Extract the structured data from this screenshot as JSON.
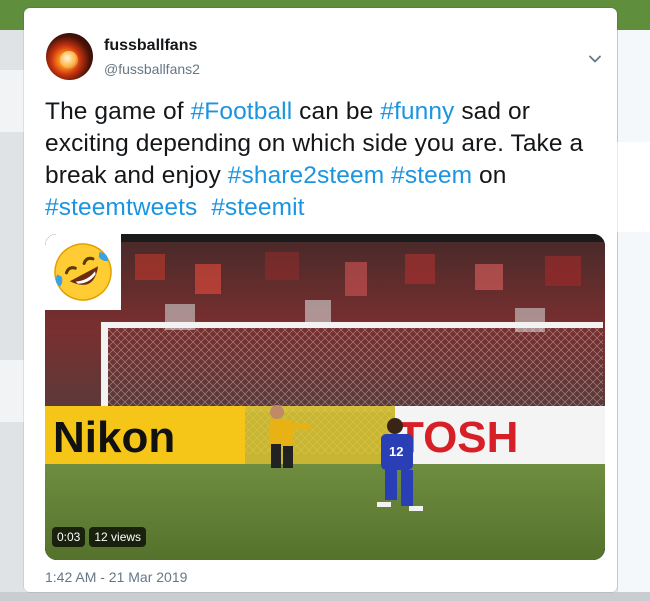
{
  "tweet": {
    "author_name": "fussballfans",
    "author_handle": "@fussballfans2",
    "text_segments": [
      {
        "text": "The game of ",
        "kind": "text"
      },
      {
        "text": "#Football",
        "kind": "hashtag"
      },
      {
        "text": " can be ",
        "kind": "text"
      },
      {
        "text": "#funny",
        "kind": "hashtag"
      },
      {
        "text": " sad or exciting depending on which side you are. Take a break and enjoy ",
        "kind": "text"
      },
      {
        "text": "#share2steem",
        "kind": "hashtag"
      },
      {
        "text": " ",
        "kind": "text"
      },
      {
        "text": "#steem",
        "kind": "hashtag"
      },
      {
        "text": " on ",
        "kind": "text"
      },
      {
        "text": "#steemtweets",
        "kind": "hashtag"
      },
      {
        "text": "  ",
        "kind": "text"
      },
      {
        "text": "#steemit",
        "kind": "hashtag"
      }
    ],
    "timestamp": "1:42 AM - 21 Mar 2019"
  },
  "media": {
    "duration": "0:03",
    "views": "12 views",
    "overlay_emoji": "rolling-on-floor-laughing-emoji",
    "banner_left": "Nikon",
    "banner_right": "TOSH",
    "player_number": "12"
  },
  "colors": {
    "hashtag": "#1b95e0",
    "text": "#14171a",
    "muted": "#657786"
  }
}
